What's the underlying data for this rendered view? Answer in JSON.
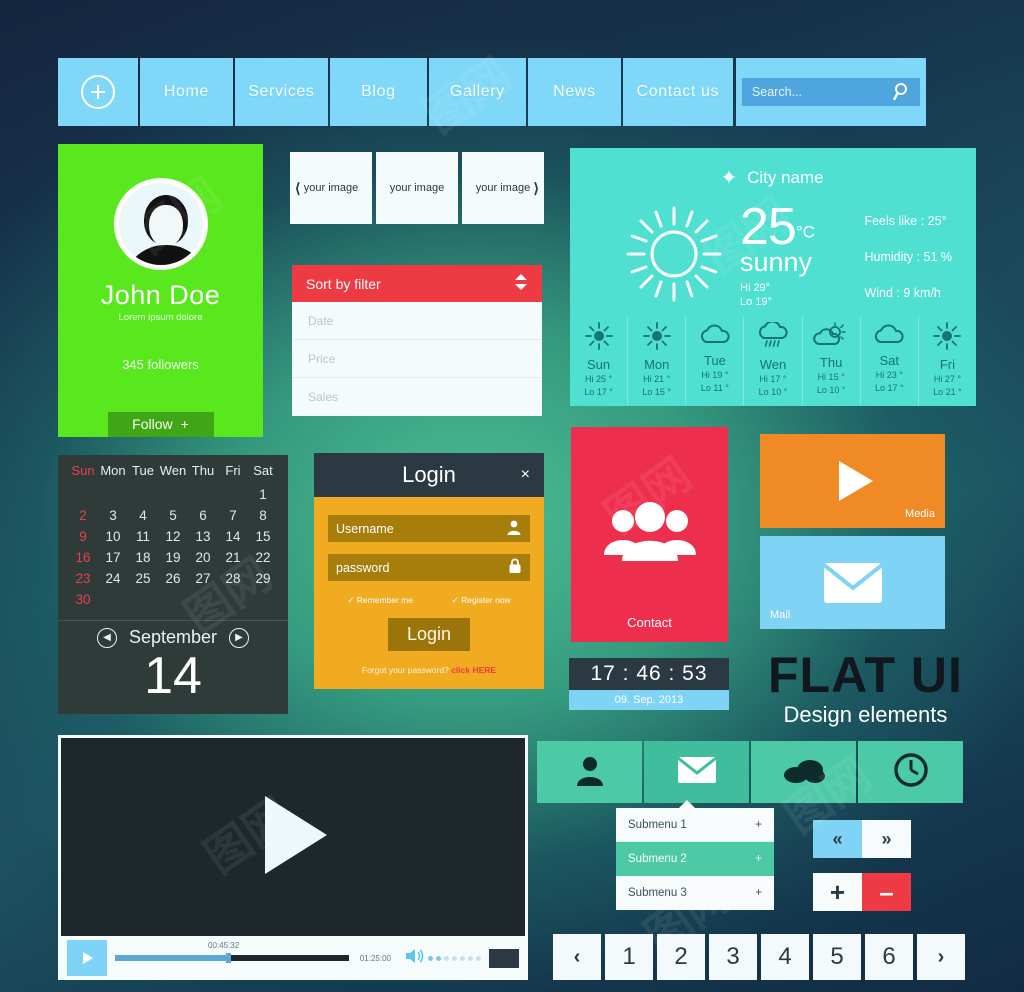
{
  "navbar": {
    "plus_icon": "plus-circle-icon",
    "items": [
      "Home",
      "Services",
      "Blog",
      "Gallery",
      "News",
      "Contact us"
    ],
    "search_placeholder": "Search...",
    "search_icon": "search-icon"
  },
  "profile": {
    "avatar_icon": "user-avatar-icon",
    "name": "John Doe",
    "subtitle": "Lorem ipsum dolore",
    "followers": "345 followers",
    "follow_label": "Follow",
    "follow_plus": "+"
  },
  "carousel": {
    "prev_icon": "chevron-left-icon",
    "next_icon": "chevron-right-icon",
    "slides": [
      "your image",
      "your image",
      "your image"
    ]
  },
  "sort": {
    "header": "Sort by filter",
    "toggle_icon": "sort-updown-icon",
    "options": [
      "Date",
      "Price",
      "Sales"
    ]
  },
  "weather": {
    "pin_icon": "location-pin-icon",
    "city": "City name",
    "sun_icon": "sun-icon",
    "temperature": "25",
    "unit": "°C",
    "condition": "sunny",
    "hi": "Hi  29°",
    "lo": "Lo   19°",
    "feels_like": "Feels like : 25°",
    "humidity": "Humidity : 51 %",
    "wind": "Wind : 9 km/h",
    "forecast": [
      {
        "day": "Sun",
        "icon": "sun-icon",
        "hi": "Hi  25 °",
        "lo": "Lo  17 °"
      },
      {
        "day": "Mon",
        "icon": "sun-icon",
        "hi": "Hi  21 °",
        "lo": "Lo  15 °"
      },
      {
        "day": "Tue",
        "icon": "cloud-icon",
        "hi": "Hi  19 °",
        "lo": "Lo  11 °"
      },
      {
        "day": "Wen",
        "icon": "rain-icon",
        "hi": "Hi  17 °",
        "lo": "Lo  10 °"
      },
      {
        "day": "Thu",
        "icon": "partly-cloudy-icon",
        "hi": "Hi  15 °",
        "lo": "Lo  10 °"
      },
      {
        "day": "Sat",
        "icon": "cloud-icon",
        "hi": "Hi  23 °",
        "lo": "Lo  17 °"
      },
      {
        "day": "Fri",
        "icon": "sun-icon",
        "hi": "Hi  27 °",
        "lo": "Lo  21 °"
      }
    ]
  },
  "calendar": {
    "weekdays": [
      "Sun",
      "Mon",
      "Tue",
      "Wen",
      "Thu",
      "Fri",
      "Sat"
    ],
    "blanks": 6,
    "days": [
      1,
      2,
      3,
      4,
      5,
      6,
      7,
      8,
      9,
      10,
      11,
      12,
      13,
      14,
      15,
      16,
      17,
      18,
      19,
      20,
      21,
      22,
      23,
      24,
      25,
      26,
      27,
      28,
      29,
      30
    ],
    "month": "September",
    "selected_day": "14",
    "prev_icon": "chevron-left-circle-icon",
    "next_icon": "chevron-right-circle-icon",
    "sunday_color": "#e8414c"
  },
  "login": {
    "title": "Login",
    "close_icon": "close-x-icon",
    "username_value": "Username",
    "username_icon": "user-icon",
    "password_value": "password",
    "password_icon": "lock-icon",
    "remember_label": "Remember me",
    "register_label": "Register now",
    "check_icon": "check-icon",
    "submit_label": "Login",
    "forgot_text": "Forgot your password?",
    "forgot_link": "click HERE"
  },
  "contact_tile": {
    "icon": "group-people-icon",
    "label": "Contact",
    "color": "#ee2e4d"
  },
  "media_tile": {
    "icon": "play-triangle-icon",
    "label": "Media",
    "color": "#f08a24"
  },
  "mail_tile": {
    "icon": "envelope-icon",
    "label": "Mail",
    "color": "#7fd3f5"
  },
  "clock": {
    "time": "17 : 46 : 53",
    "date": "09. Sep. 2013"
  },
  "flatui": {
    "line1": "FLAT UI",
    "line2": "Design elements"
  },
  "player": {
    "big_play_icon": "play-triangle-icon",
    "play_icon": "play-small-icon",
    "current_time": "00:45:32",
    "total_time": "01:25:00",
    "progress_percent": 40,
    "volume_icon": "speaker-icon",
    "volume_dots_on": 2,
    "volume_dots_total": 7,
    "fullscreen_icon": "fullscreen-icon"
  },
  "iconmenu": {
    "tiles": [
      {
        "icon": "user-icon",
        "active": false
      },
      {
        "icon": "envelope-icon",
        "active": true
      },
      {
        "icon": "cloud-icon",
        "active": false
      },
      {
        "icon": "clock-icon",
        "active": false
      }
    ]
  },
  "submenu": {
    "items": [
      {
        "label": "Submenu 1",
        "plus": "+",
        "active": false
      },
      {
        "label": "Submenu 2",
        "plus": "+",
        "active": true
      },
      {
        "label": "Submenu 3",
        "plus": "+",
        "active": false
      }
    ]
  },
  "arrow_buttons": {
    "prev": "«",
    "next": "»"
  },
  "plusminus_buttons": {
    "plus": "+",
    "minus": "–"
  },
  "pagination": {
    "prev_icon": "chevron-left-icon",
    "next_icon": "chevron-right-icon",
    "prev": "‹",
    "pages": [
      "1",
      "2",
      "3",
      "4",
      "5",
      "6"
    ],
    "next": "›"
  },
  "watermark": {
    "text": "图网"
  }
}
